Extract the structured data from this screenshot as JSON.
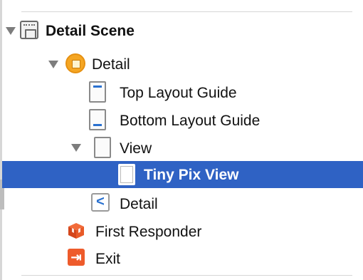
{
  "outline": {
    "items": [
      {
        "label": "Detail Scene",
        "icon": "storyboard-scene-icon",
        "bold": true,
        "expanded": true
      },
      {
        "label": "Detail",
        "icon": "view-controller-icon",
        "expanded": true
      },
      {
        "label": "Top Layout Guide",
        "icon": "top-layout-guide-icon"
      },
      {
        "label": "Bottom Layout Guide",
        "icon": "bottom-layout-guide-icon"
      },
      {
        "label": "View",
        "icon": "view-icon",
        "expanded": true
      },
      {
        "label": "Tiny Pix View",
        "icon": "view-icon",
        "selected": true
      },
      {
        "label": "Detail",
        "icon": "back-button-icon",
        "glyph": "<"
      },
      {
        "label": "First Responder",
        "icon": "first-responder-icon"
      },
      {
        "label": "Exit",
        "icon": "exit-icon",
        "glyph": "⇥"
      }
    ]
  },
  "colors": {
    "selection": "#2f62c4",
    "accent_blue": "#2a71d0",
    "view_controller": "#f5a623",
    "exit": "#ee5b2b"
  }
}
